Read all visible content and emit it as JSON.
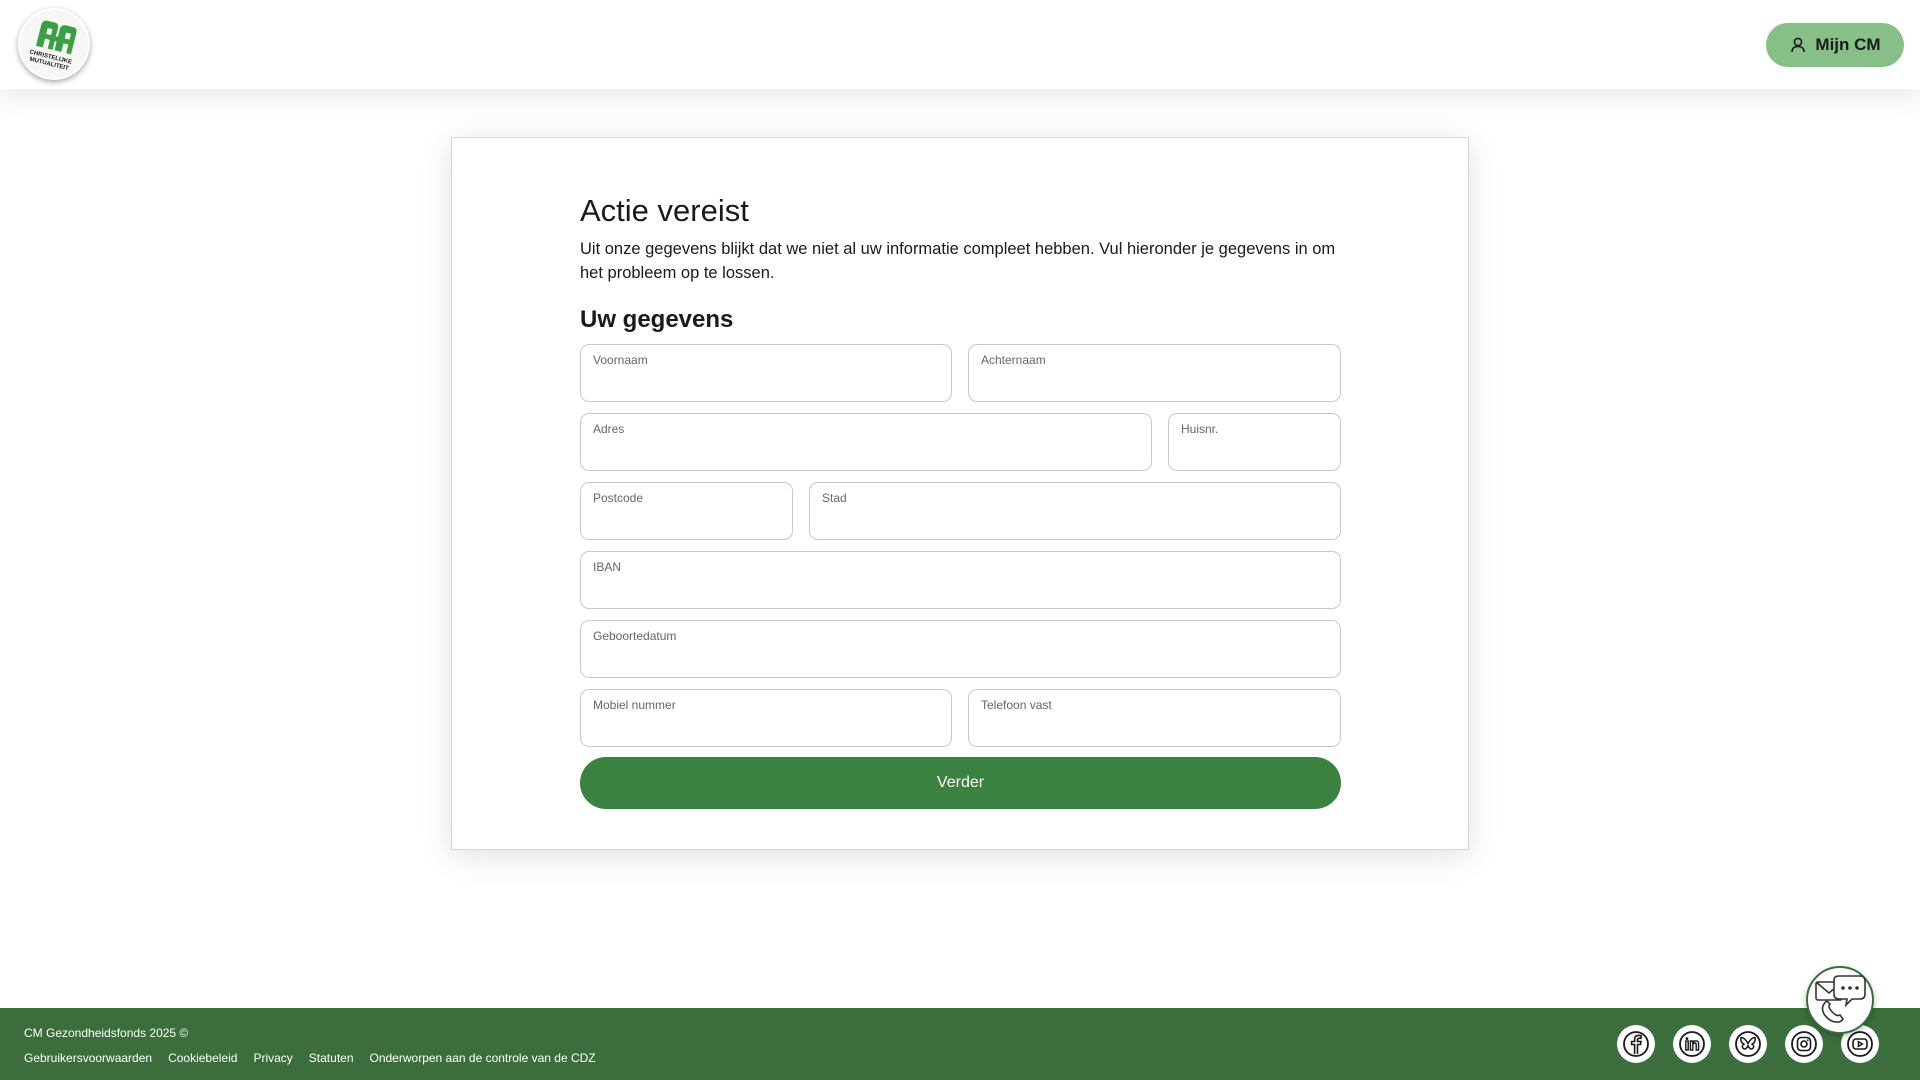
{
  "header": {
    "logo_text": [
      "CHRISTELIJKE",
      "MUTUALITEIT"
    ],
    "account_button_label": "Mijn CM"
  },
  "form": {
    "title": "Actie vereist",
    "intro": "Uit onze gegevens blijkt dat we niet al uw informatie compleet hebben. Vul hieronder je gegevens in om het probleem op te lossen.",
    "subtitle": "Uw gegevens",
    "fields": {
      "voornaam": {
        "label": "Voornaam",
        "value": ""
      },
      "achternaam": {
        "label": "Achternaam",
        "value": ""
      },
      "adres": {
        "label": "Adres",
        "value": ""
      },
      "huisnr": {
        "label": "Huisnr.",
        "value": ""
      },
      "postcode": {
        "label": "Postcode",
        "value": ""
      },
      "stad": {
        "label": "Stad",
        "value": ""
      },
      "iban": {
        "label": "IBAN",
        "value": ""
      },
      "geboortedatum": {
        "label": "Geboortedatum",
        "value": ""
      },
      "mobiel": {
        "label": "Mobiel nummer",
        "value": ""
      },
      "telefoon": {
        "label": "Telefoon vast",
        "value": ""
      }
    },
    "submit_label": "Verder"
  },
  "footer": {
    "copyright": "CM Gezondheidsfonds 2025 ©",
    "links": [
      "Gebruikersvoorwaarden",
      "Cookiebeleid",
      "Privacy",
      "Statuten",
      "Onderworpen aan de controle van de CDZ"
    ],
    "social_icons": [
      "facebook-icon",
      "linkedin-icon",
      "bluesky-icon",
      "instagram-icon",
      "youtube-icon"
    ]
  },
  "colors": {
    "brand_green": "#3b8140",
    "footer_green": "#3b6e3c",
    "button_light_green": "#86c087"
  }
}
